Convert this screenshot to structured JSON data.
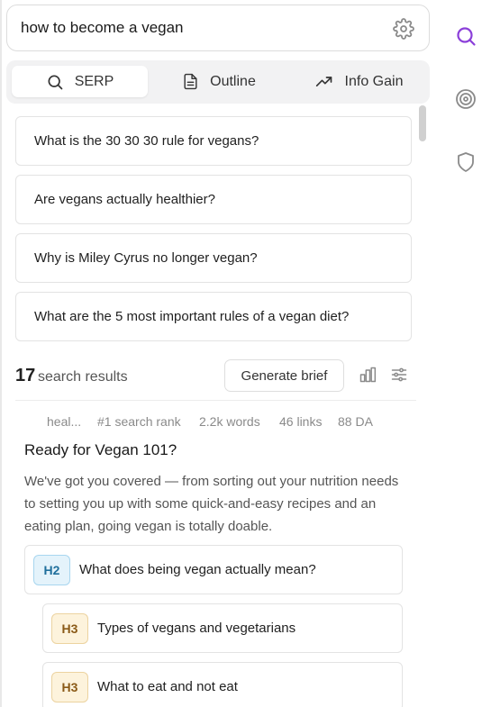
{
  "search": {
    "query": "how to become a vegan"
  },
  "tabs": [
    {
      "label": "SERP",
      "icon": "search-icon",
      "active": true
    },
    {
      "label": "Outline",
      "icon": "document-icon",
      "active": false
    },
    {
      "label": "Info Gain",
      "icon": "trending-up-icon",
      "active": false
    }
  ],
  "questions": [
    "What is the 30 30 30 rule for vegans?",
    "Are vegans actually healthier?",
    "Why is Miley Cyrus no longer vegan?",
    "What are the 5 most important rules of a vegan diet?"
  ],
  "results": {
    "count": "17",
    "count_label": "search results",
    "generate_brief": "Generate brief"
  },
  "result": {
    "domain": "heal...",
    "rank": "#1 search rank",
    "words": "2.2k words",
    "links": "46 links",
    "da": "88 DA",
    "title": "Ready for Vegan 101?",
    "description": "We've got you covered — from sorting out your nutrition needs to setting you up with some quick-and-easy recipes and an eating plan, going vegan is totally doable.",
    "headings": [
      {
        "level": "H2",
        "text": "What does being vegan actually mean?"
      },
      {
        "level": "H3",
        "text": "Types of vegans and vegetarians"
      },
      {
        "level": "H3",
        "text": "What to eat and not eat"
      }
    ]
  },
  "rail": [
    {
      "icon": "search-icon",
      "active": true
    },
    {
      "icon": "target-icon",
      "active": false
    },
    {
      "icon": "shield-icon",
      "active": false
    }
  ],
  "colors": {
    "accent": "#8b3fd9",
    "muted_icon": "#8a8a8a"
  }
}
